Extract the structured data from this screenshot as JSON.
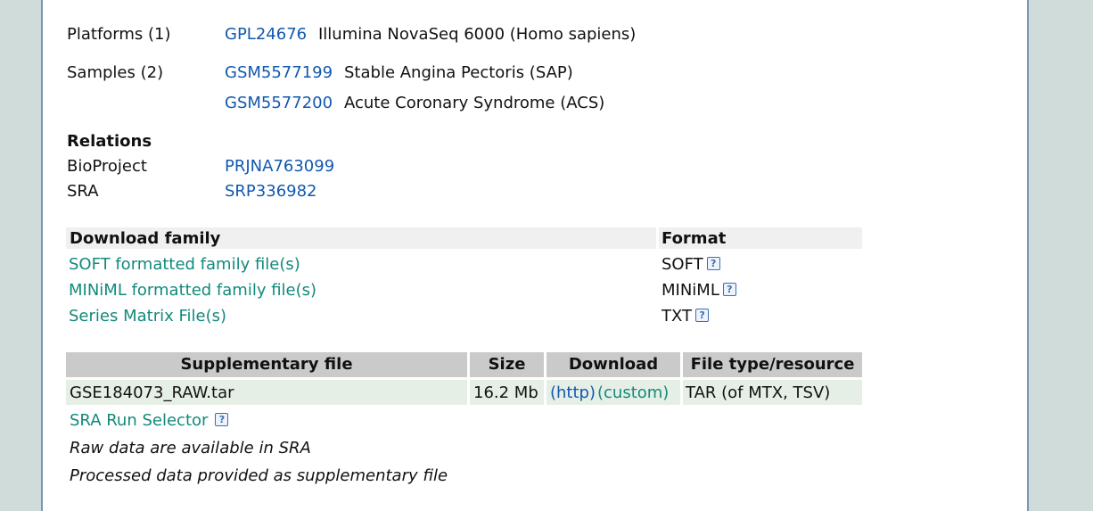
{
  "platforms": {
    "label": "Platforms (1)",
    "items": [
      {
        "id": "GPL24676",
        "desc": "Illumina NovaSeq 6000 (Homo sapiens)"
      }
    ]
  },
  "samples": {
    "label": "Samples (2)",
    "items": [
      {
        "id": "GSM5577199",
        "desc": "Stable Angina Pectoris (SAP)"
      },
      {
        "id": "GSM5577200",
        "desc": "Acute Coronary Syndrome (ACS)"
      }
    ]
  },
  "relations": {
    "title": "Relations",
    "bioproject_label": "BioProject",
    "bioproject_value": "PRJNA763099",
    "sra_label": "SRA",
    "sra_value": "SRP336982"
  },
  "download_family": {
    "header": "Download family",
    "format_header": "Format",
    "rows": [
      {
        "label": "SOFT formatted family file(s)",
        "format": "SOFT",
        "help_icon": "help-icon"
      },
      {
        "label": "MINiML formatted family file(s)",
        "format": "MINiML",
        "help_icon": "help-icon"
      },
      {
        "label": "Series Matrix File(s)",
        "format": "TXT",
        "help_icon": "help-icon"
      }
    ]
  },
  "supplementary": {
    "headers": [
      "Supplementary file",
      "Size",
      "Download",
      "File type/resource"
    ],
    "rows": [
      {
        "file": "GSE184073_RAW.tar",
        "size": "16.2 Mb",
        "http": "(http)",
        "custom": "(custom)",
        "type": "TAR (of MTX, TSV)"
      }
    ],
    "sra_run_selector": "SRA Run Selector",
    "note1": "Raw data are available in SRA",
    "note2": "Processed data provided as supplementary file"
  },
  "colors": {
    "link_blue": "#1158b0",
    "link_teal": "#128a7b",
    "page_bg": "#cfdcda",
    "panel_border": "#7d94b6"
  }
}
